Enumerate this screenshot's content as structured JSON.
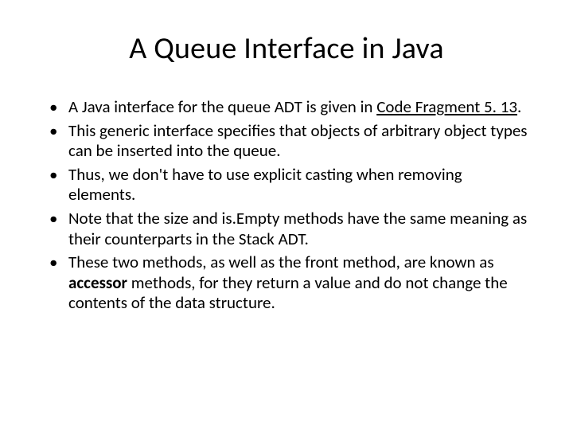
{
  "title": "A Queue Interface in Java",
  "bullets": {
    "item0_pre": "A Java interface for the queue ADT is given in ",
    "item0_link": "Code Fragment 5. 13",
    "item0_post": ".",
    "item1": "This generic interface specifies that objects of arbitrary object types can be inserted into the queue.",
    "item2": "Thus, we don't have to use explicit casting when removing elements.",
    "item3": "Note that the size and is.Empty methods have the same meaning as their counterparts in the Stack ADT.",
    "item4_pre": "These two methods, as well as the front method, are known as ",
    "item4_bold": "accessor",
    "item4_post": " methods, for they return a value and do not change the contents of the data structure."
  }
}
